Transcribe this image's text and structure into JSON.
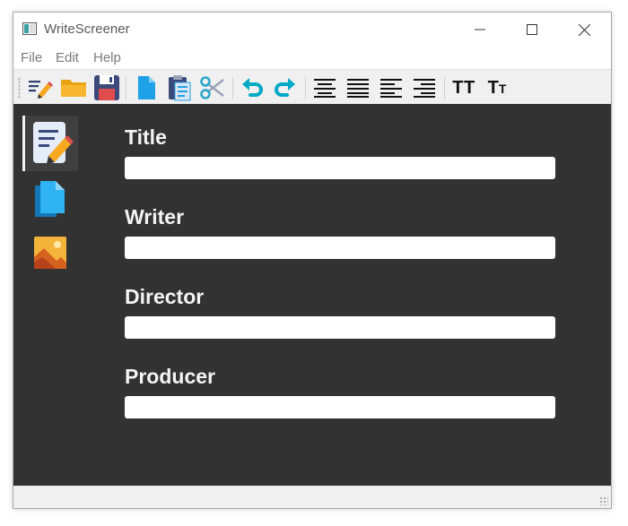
{
  "window": {
    "title": "WriteScreener",
    "controls": [
      "minimize",
      "maximize",
      "close"
    ]
  },
  "menu": {
    "items": [
      {
        "label": "File"
      },
      {
        "label": "Edit"
      },
      {
        "label": "Help"
      }
    ]
  },
  "toolbar": {
    "buttons": [
      {
        "name": "edit",
        "icon": "edit-pencil-icon"
      },
      {
        "name": "open",
        "icon": "folder-icon"
      },
      {
        "name": "save",
        "icon": "floppy-disk-icon"
      },
      {
        "name": "copy",
        "icon": "copy-icon"
      },
      {
        "name": "paste",
        "icon": "clipboard-icon"
      },
      {
        "name": "cut",
        "icon": "scissors-icon"
      },
      {
        "name": "undo",
        "icon": "undo-icon"
      },
      {
        "name": "redo",
        "icon": "redo-icon"
      },
      {
        "name": "align-center",
        "icon": "align-center-icon"
      },
      {
        "name": "justify",
        "icon": "justify-icon"
      },
      {
        "name": "align-left",
        "icon": "align-left-icon"
      },
      {
        "name": "align-right",
        "icon": "align-right-icon"
      },
      {
        "name": "uppercase",
        "label": "TT"
      },
      {
        "name": "small-caps",
        "label_big": "T",
        "label_small": "T"
      }
    ]
  },
  "sidebar": {
    "items": [
      {
        "name": "title-page",
        "icon": "document-edit-icon",
        "active": true
      },
      {
        "name": "pages",
        "icon": "pages-icon",
        "active": false
      },
      {
        "name": "images",
        "icon": "image-icon",
        "active": false
      }
    ]
  },
  "form": {
    "fields": [
      {
        "label": "Title",
        "value": ""
      },
      {
        "label": "Writer",
        "value": ""
      },
      {
        "label": "Director",
        "value": ""
      },
      {
        "label": "Producer",
        "value": ""
      }
    ]
  },
  "colors": {
    "content_bg": "#323232",
    "label": "#f4f4f4",
    "accent_blue": "#1ea1e6",
    "accent_teal": "#00aac6"
  }
}
